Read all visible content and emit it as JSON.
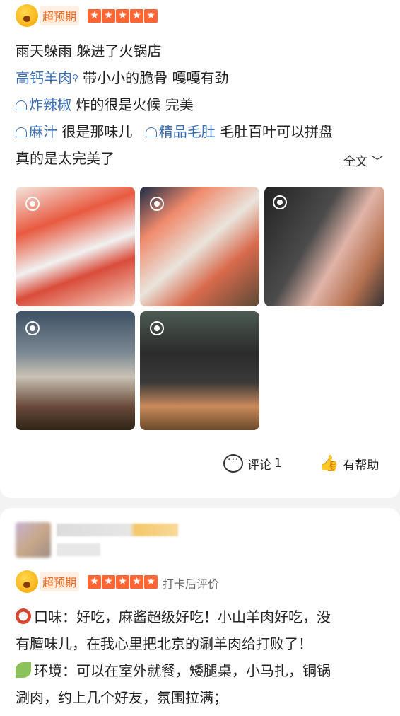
{
  "review1": {
    "badge": "超预期",
    "lines": {
      "l1": "雨天躲雨 躲进了火锅店",
      "l2_tag": "高钙羊肉",
      "l2_text": "带小小的脆骨 嘎嘎有劲",
      "l3_tag": "炸辣椒",
      "l3_text": "炸的很是火候 完美",
      "l4_tag1": "麻汁",
      "l4_text1": "很是那味儿",
      "l4_tag2": "精品毛肚",
      "l4_text2": "毛肚百叶可以拼盘",
      "l5": "真的是太完美了"
    },
    "full_text_label": "全文",
    "comment_label": "评论",
    "comment_count": "1",
    "helpful_label": "有帮助"
  },
  "review2": {
    "badge": "超预期",
    "rating_note": "打卡后评价",
    "taste_line1": "口味：好吃，麻酱超级好吃！小山羊肉好吃，没",
    "taste_line2": "有膻味儿，在我心里把北京的涮羊肉给打败了！",
    "env_line1": "环境：可以在室外就餐，矮腿桌，小马扎，铜锅",
    "env_line2": "涮肉，约上几个好友，氛围拉满；"
  },
  "colors": {
    "accent": "#ff6633",
    "link": "#3a6fb5"
  }
}
